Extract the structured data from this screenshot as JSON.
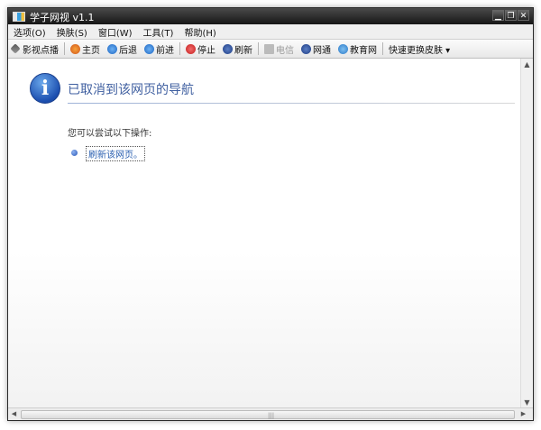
{
  "window": {
    "title": "学子网视 v1.1",
    "minimize": "▁",
    "restore": "❐",
    "close": "✕"
  },
  "menu": [
    {
      "label": "选项(O)"
    },
    {
      "label": "换肤(S)"
    },
    {
      "label": "窗口(W)"
    },
    {
      "label": "工具(T)"
    },
    {
      "label": "帮助(H)"
    }
  ],
  "toolbar": {
    "vod": "影视点播",
    "home": "主页",
    "back": "后退",
    "forward": "前进",
    "stop": "停止",
    "refresh": "刷新",
    "telecom": "电信",
    "netcom": "网通",
    "edunet": "教育网",
    "skin": "快速更换皮肤 ▾"
  },
  "page": {
    "headline": "已取消到该网页的导航",
    "subtext": "您可以尝试以下操作:",
    "link": "刷新该网页。"
  },
  "colors": {
    "headline": "#3f5fa0",
    "link": "#2a5fb0"
  }
}
